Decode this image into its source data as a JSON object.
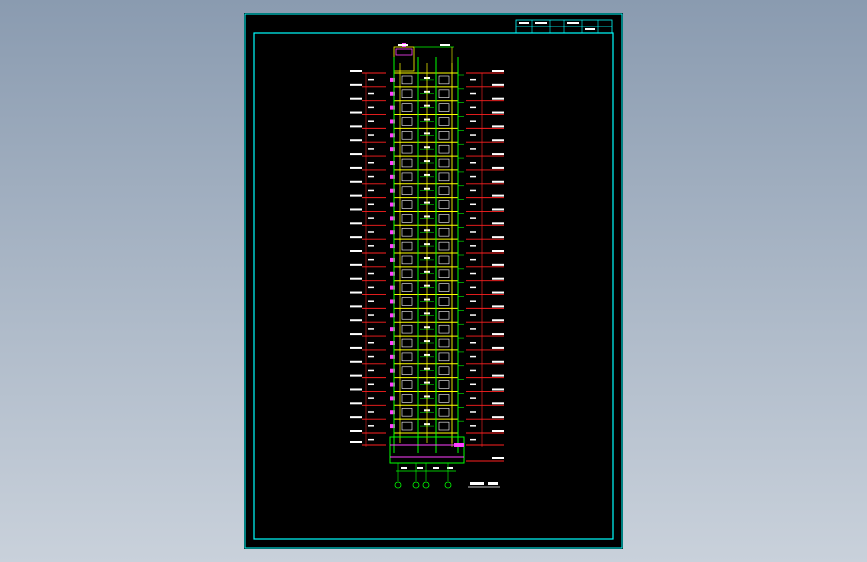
{
  "viewport": {
    "background_top": "#8a9bb0",
    "background_bottom": "#c9d1db"
  },
  "sheet": {
    "background": "#000000",
    "frame_color": "#00ffff",
    "title_block_color": "#00ffff"
  },
  "drawing": {
    "floor_count": 26,
    "colors": {
      "level_lines": "#ff2020",
      "structure": "#ffff00",
      "walls": "#00ff00",
      "windows": "#ffffff",
      "highlight": "#ff40ff",
      "dimension_text": "#ffffff",
      "grid_axis": "#00ff00"
    },
    "grid_axes": [
      "1",
      "2",
      "3",
      "4"
    ]
  }
}
